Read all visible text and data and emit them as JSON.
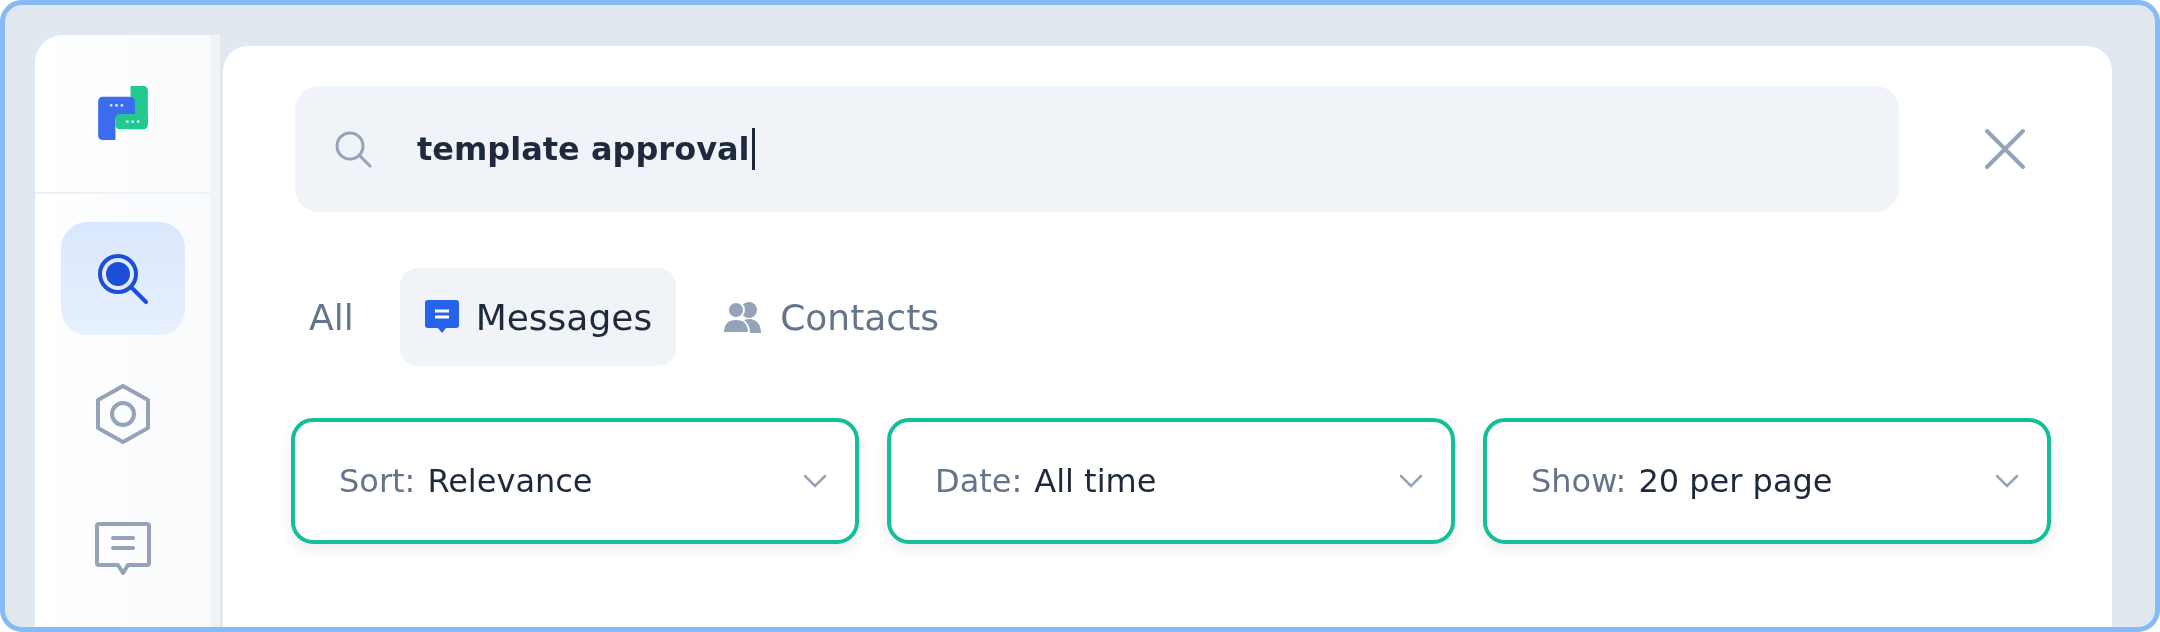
{
  "search": {
    "value": "template approval"
  },
  "sidebar": {
    "items": [
      {
        "kind": "search",
        "selected": true
      },
      {
        "kind": "hexagon",
        "selected": false
      },
      {
        "kind": "chat",
        "selected": false
      }
    ]
  },
  "tabs": [
    {
      "label": "All",
      "kind": "plain",
      "selected": false
    },
    {
      "label": "Messages",
      "kind": "messages",
      "selected": true
    },
    {
      "label": "Contacts",
      "kind": "contacts",
      "selected": false
    }
  ],
  "filters": [
    {
      "label": "Sort:",
      "value": "Relevance"
    },
    {
      "label": "Date:",
      "value": "All time"
    },
    {
      "label": "Show:",
      "value": "20 per page"
    }
  ]
}
